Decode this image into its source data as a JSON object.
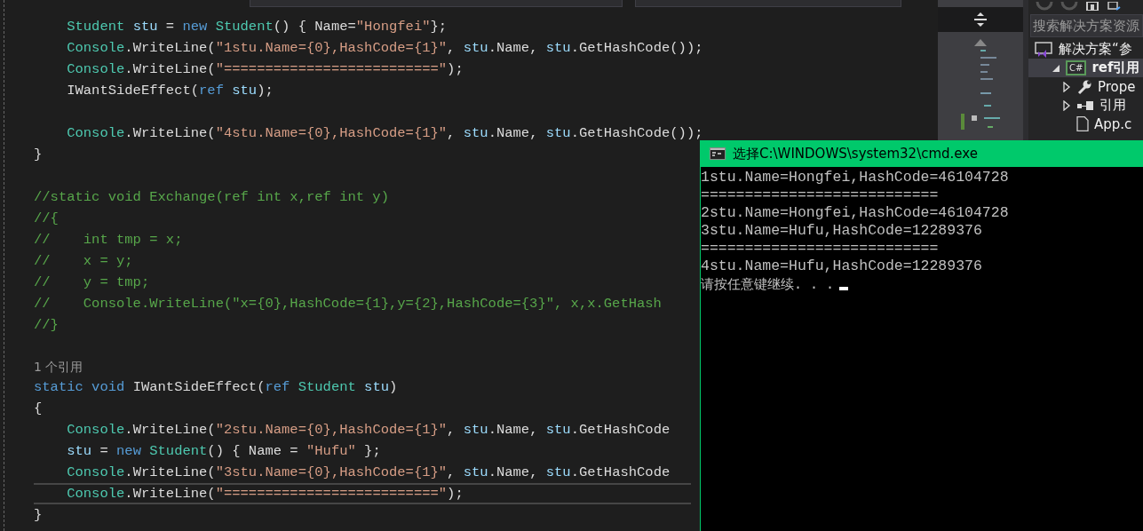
{
  "editor": {
    "lines": [
      {
        "kind": "code",
        "current": false,
        "tokens": [
          {
            "kind": "type",
            "t": "    Student"
          },
          {
            "kind": "var",
            "t": " stu"
          },
          {
            "kind": "plain",
            "t": " = "
          },
          {
            "kind": "kw",
            "t": "new"
          },
          {
            "kind": "type",
            "t": " Student"
          },
          {
            "kind": "plain",
            "t": "() { Name="
          },
          {
            "kind": "str",
            "t": "\"Hongfei\""
          },
          {
            "kind": "plain",
            "t": "};"
          }
        ]
      },
      {
        "kind": "code",
        "current": false,
        "tokens": [
          {
            "kind": "type",
            "t": "    Console"
          },
          {
            "kind": "plain",
            "t": ".WriteLine("
          },
          {
            "kind": "str",
            "t": "\"1stu.Name={0},HashCode={1}\""
          },
          {
            "kind": "plain",
            "t": ", "
          },
          {
            "kind": "var",
            "t": "stu"
          },
          {
            "kind": "plain",
            "t": ".Name, "
          },
          {
            "kind": "var",
            "t": "stu"
          },
          {
            "kind": "plain",
            "t": ".GetHashCode());"
          }
        ]
      },
      {
        "kind": "code",
        "current": false,
        "tokens": [
          {
            "kind": "type",
            "t": "    Console"
          },
          {
            "kind": "plain",
            "t": ".WriteLine("
          },
          {
            "kind": "str",
            "t": "\"==========================\""
          },
          {
            "kind": "plain",
            "t": ");"
          }
        ]
      },
      {
        "kind": "code",
        "current": false,
        "tokens": [
          {
            "kind": "plain",
            "t": "    IWantSideEffect("
          },
          {
            "kind": "kw",
            "t": "ref"
          },
          {
            "kind": "var",
            "t": " stu"
          },
          {
            "kind": "plain",
            "t": ");"
          }
        ]
      },
      {
        "kind": "blank"
      },
      {
        "kind": "code",
        "current": false,
        "tokens": [
          {
            "kind": "type",
            "t": "    Console"
          },
          {
            "kind": "plain",
            "t": ".WriteLine("
          },
          {
            "kind": "str",
            "t": "\"4stu.Name={0},HashCode={1}\""
          },
          {
            "kind": "plain",
            "t": ", "
          },
          {
            "kind": "var",
            "t": "stu"
          },
          {
            "kind": "plain",
            "t": ".Name, "
          },
          {
            "kind": "var",
            "t": "stu"
          },
          {
            "kind": "plain",
            "t": ".GetHashCode());"
          }
        ]
      },
      {
        "kind": "code",
        "current": false,
        "tokens": [
          {
            "kind": "plain",
            "t": "}"
          }
        ]
      },
      {
        "kind": "blank"
      },
      {
        "kind": "code",
        "current": false,
        "tokens": [
          {
            "kind": "comment",
            "t": "//static void Exchange(ref int x,ref int y)"
          }
        ]
      },
      {
        "kind": "code",
        "current": false,
        "tokens": [
          {
            "kind": "comment",
            "t": "//{"
          }
        ]
      },
      {
        "kind": "code",
        "current": false,
        "tokens": [
          {
            "kind": "comment",
            "t": "//    int tmp = x;"
          }
        ]
      },
      {
        "kind": "code",
        "current": false,
        "tokens": [
          {
            "kind": "comment",
            "t": "//    x = y;"
          }
        ]
      },
      {
        "kind": "code",
        "current": false,
        "tokens": [
          {
            "kind": "comment",
            "t": "//    y = tmp;"
          }
        ]
      },
      {
        "kind": "code",
        "current": false,
        "tokens": [
          {
            "kind": "comment",
            "t": "//    Console.WriteLine(\"x={0},HashCode={1},y={2},HashCode={3}\", x,x.GetHash"
          }
        ]
      },
      {
        "kind": "code",
        "current": false,
        "tokens": [
          {
            "kind": "comment",
            "t": "//}"
          }
        ]
      },
      {
        "kind": "blank"
      },
      {
        "kind": "lens",
        "current": false,
        "tokens": [
          {
            "kind": "lens",
            "t": "1 个引用"
          }
        ]
      },
      {
        "kind": "code",
        "current": false,
        "tokens": [
          {
            "kind": "kw",
            "t": "static void"
          },
          {
            "kind": "plain",
            "t": " IWantSideEffect("
          },
          {
            "kind": "kw",
            "t": "ref"
          },
          {
            "kind": "type",
            "t": " Student"
          },
          {
            "kind": "var",
            "t": " stu"
          },
          {
            "kind": "plain",
            "t": ")"
          }
        ]
      },
      {
        "kind": "code",
        "current": false,
        "tokens": [
          {
            "kind": "plain",
            "t": "{"
          }
        ]
      },
      {
        "kind": "code",
        "current": false,
        "tokens": [
          {
            "kind": "type",
            "t": "    Console"
          },
          {
            "kind": "plain",
            "t": ".WriteLine("
          },
          {
            "kind": "str",
            "t": "\"2stu.Name={0},HashCode={1}\""
          },
          {
            "kind": "plain",
            "t": ", "
          },
          {
            "kind": "var",
            "t": "stu"
          },
          {
            "kind": "plain",
            "t": ".Name, "
          },
          {
            "kind": "var",
            "t": "stu"
          },
          {
            "kind": "plain",
            "t": ".GetHashCode"
          }
        ]
      },
      {
        "kind": "code",
        "current": false,
        "tokens": [
          {
            "kind": "var",
            "t": "    stu"
          },
          {
            "kind": "plain",
            "t": " = "
          },
          {
            "kind": "kw",
            "t": "new"
          },
          {
            "kind": "type",
            "t": " Student"
          },
          {
            "kind": "plain",
            "t": "() { Name = "
          },
          {
            "kind": "str",
            "t": "\"Hufu\""
          },
          {
            "kind": "plain",
            "t": " };"
          }
        ]
      },
      {
        "kind": "code",
        "current": false,
        "tokens": [
          {
            "kind": "type",
            "t": "    Console"
          },
          {
            "kind": "plain",
            "t": ".WriteLine("
          },
          {
            "kind": "str",
            "t": "\"3stu.Name={0},HashCode={1}\""
          },
          {
            "kind": "plain",
            "t": ", "
          },
          {
            "kind": "var",
            "t": "stu"
          },
          {
            "kind": "plain",
            "t": ".Name, "
          },
          {
            "kind": "var",
            "t": "stu"
          },
          {
            "kind": "plain",
            "t": ".GetHashCode"
          }
        ]
      },
      {
        "kind": "code",
        "current": true,
        "tokens": [
          {
            "kind": "type",
            "t": "    Console"
          },
          {
            "kind": "plain",
            "t": ".WriteLine("
          },
          {
            "kind": "str",
            "t": "\"==========================\""
          },
          {
            "kind": "plain",
            "t": ");"
          }
        ]
      },
      {
        "kind": "code",
        "current": false,
        "tokens": [
          {
            "kind": "plain",
            "t": "}"
          }
        ]
      }
    ]
  },
  "solution_explorer": {
    "search": {
      "placeholder": "搜索解决方案资源"
    },
    "tree": [
      {
        "label": "解决方案“参",
        "kind": "solution",
        "selected": false,
        "children": [
          {
            "label": "ref引用",
            "kind": "project",
            "icon_text": "C#",
            "selected": true,
            "expanded": true,
            "children": [
              {
                "label": "Prope",
                "kind": "properties",
                "selected": false,
                "expanded": false
              },
              {
                "label": "引用",
                "kind": "references",
                "selected": false,
                "expanded": false
              },
              {
                "label": "App.c",
                "kind": "file",
                "selected": false
              }
            ]
          }
        ]
      }
    ]
  },
  "console": {
    "title": "选择C:\\WINDOWS\\system32\\cmd.exe",
    "output": [
      "1stu.Name=Hongfei,HashCode=46104728",
      "===========================",
      "2stu.Name=Hongfei,HashCode=46104728",
      "3stu.Name=Hufu,HashCode=12289376",
      "===========================",
      "4stu.Name=Hufu,HashCode=12289376"
    ],
    "prompt": "请按任意键继续. . ."
  }
}
